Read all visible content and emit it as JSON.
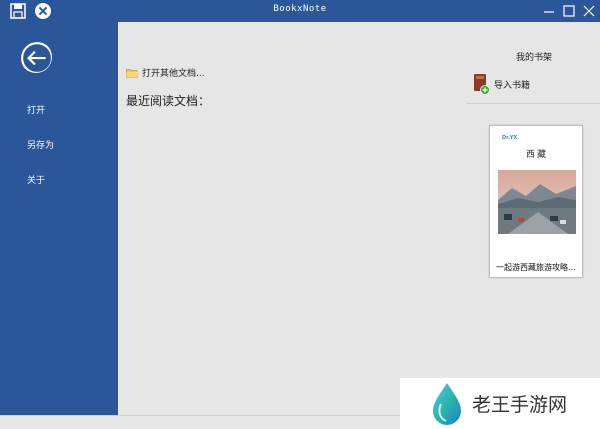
{
  "window": {
    "title": "BookxNote"
  },
  "sidebar": {
    "items": [
      {
        "label": "打开"
      },
      {
        "label": "另存为"
      },
      {
        "label": "关于"
      }
    ]
  },
  "main": {
    "open_other_label": "打开其他文档...",
    "recent_title": "最近阅读文档："
  },
  "shelf": {
    "title": "我的书架",
    "import_label": "导入书籍",
    "books": [
      {
        "cover_logo": "Dr.YX",
        "cover_title": "西藏",
        "name": "一起游西藏旅游攻略..."
      }
    ]
  },
  "watermark": {
    "text": "老王手游网"
  },
  "colors": {
    "accent": "#2b579a",
    "background": "#e6e6e6"
  }
}
